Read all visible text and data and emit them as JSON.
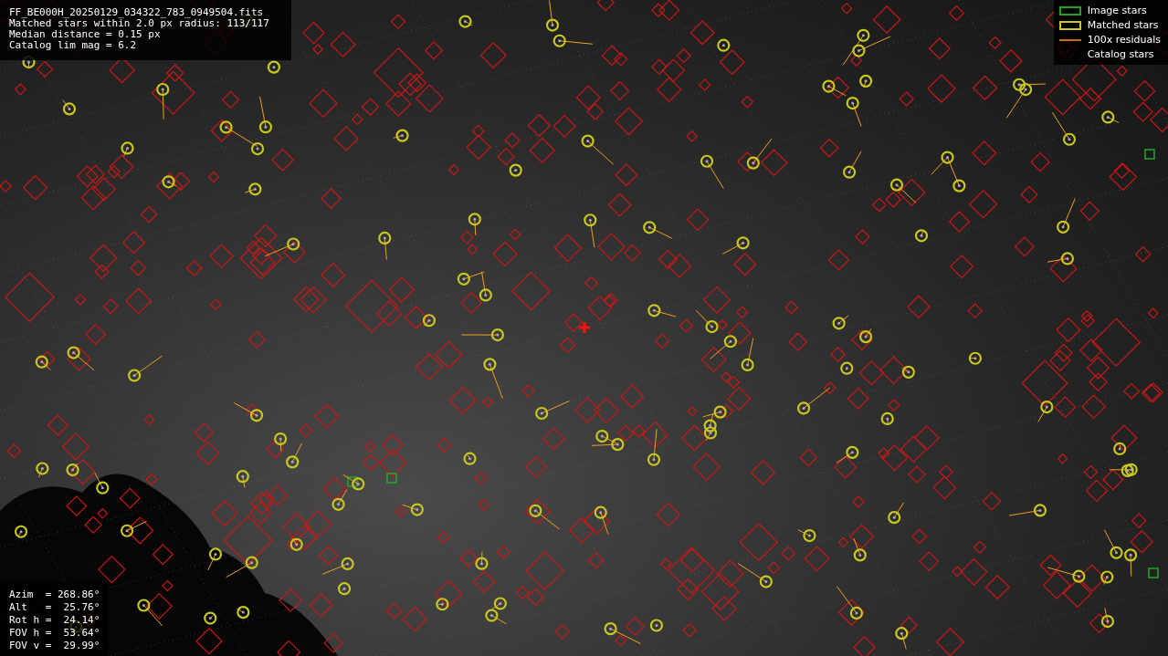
{
  "info": {
    "lines": [
      "FF_BE000H_20250129_034322_783_0949504.fits",
      "Matched stars within 2.0 px radius: 113/117",
      "Median distance = 0.15 px",
      "Catalog lim mag = 6.2"
    ]
  },
  "legend": [
    {
      "kind": "image",
      "label": "Image stars"
    },
    {
      "kind": "matched",
      "label": "Matched stars"
    },
    {
      "kind": "residual",
      "label": "100x residuals"
    },
    {
      "kind": "catalog",
      "label": "Catalog stars"
    }
  ],
  "pointing": {
    "lines": [
      "Azim  = 268.86°",
      "Alt   =  25.76°",
      "Rot h =  24.14°",
      "FOV h =  53.64°",
      "FOV v =  29.99°"
    ]
  }
}
